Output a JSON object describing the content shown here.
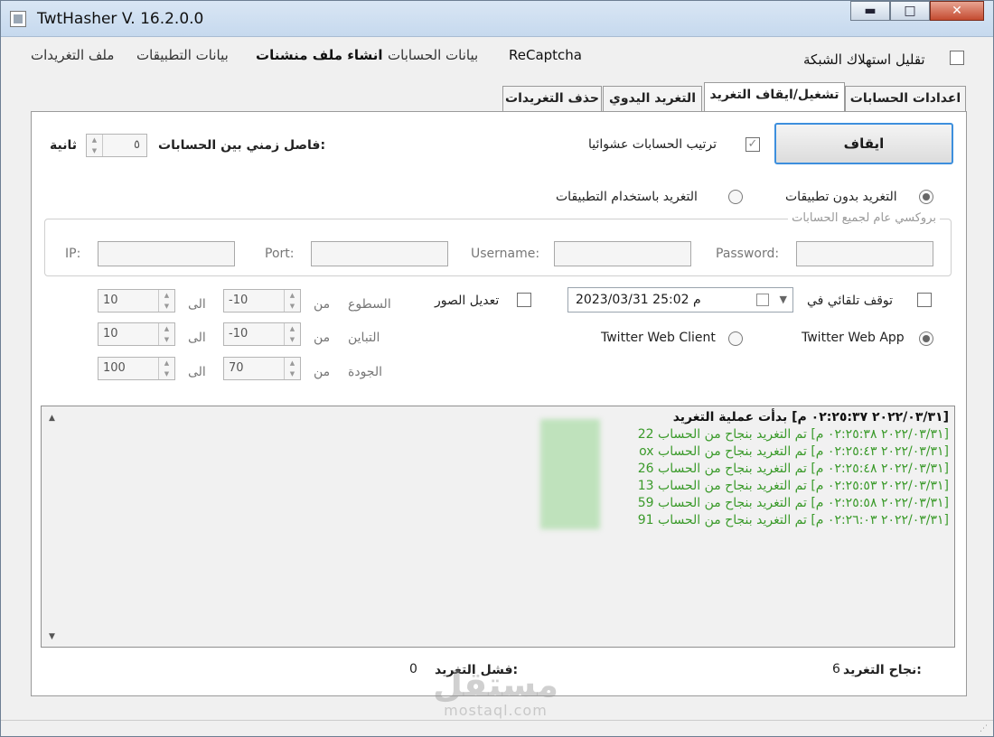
{
  "window": {
    "title": "TwtHasher V. 16.2.0.0",
    "minimize": "▬",
    "maximize": "□",
    "close": "✕"
  },
  "menu": {
    "reduce_network_label": "تقليل استهلاك الشبكة",
    "reduce_network_checked": false,
    "items": [
      "ReCaptcha",
      "بيانات الحسابات",
      "انشاء ملف منشنات",
      "بيانات التطبيقات",
      "ملف التغريدات"
    ]
  },
  "tabs": [
    "اعدادات الحسابات",
    "تشغيل/ايقاف التغريد",
    "التغريد اليدوي",
    "حذف التغريدات"
  ],
  "active_tab": 1,
  "controls": {
    "stop_button": "ايقاف",
    "random_order_label": "ترتيب الحسابات عشوائيا",
    "random_order_checked": true,
    "interval_label": "فاصل زمني بين الحسابات:",
    "interval_value": "٥",
    "interval_unit": "ثانية",
    "mode_no_apps": "التغريد بدون تطبيقات",
    "mode_with_apps": "التغريد باستخدام التطبيقات",
    "selected_mode": "no_apps"
  },
  "proxy": {
    "legend": "بروكسي عام لجميع الحسابات",
    "password_label": "Password:",
    "username_label": "Username:",
    "port_label": "Port:",
    "ip_label": "IP:",
    "password": "",
    "username": "",
    "port": "",
    "ip": ""
  },
  "schedule": {
    "auto_stop_label": "توقف تلقائي في",
    "auto_stop_checked": false,
    "date_value": "م  25:02 2023/03/31"
  },
  "image_edit": {
    "label": "تعديل الصور",
    "checked": false,
    "brightness": {
      "label": "السطوع",
      "from_label": "من",
      "from": "-10",
      "to_label": "الى",
      "to": "10"
    },
    "contrast": {
      "label": "التباين",
      "from_label": "من",
      "from": "-10",
      "to_label": "الى",
      "to": "10"
    },
    "quality": {
      "label": "الجودة",
      "from_label": "من",
      "from": "70",
      "to_label": "الى",
      "to": "100"
    }
  },
  "client": {
    "web_app": "Twitter Web App",
    "web_client": "Twitter Web Client",
    "selected": "web_app"
  },
  "log": {
    "lines": [
      {
        "type": "head",
        "text": "[٢٠٢٢/٠٣/٣١ ٠٢:٢٥:٣٧ م] بدأت عملية التغريد"
      },
      {
        "type": "ok",
        "text": "[٢٠٢٢/٠٣/٣١ ٠٢:٢٥:٣٨ م] تم التغريد بنجاح من الحساب 22"
      },
      {
        "type": "ok",
        "text": "[٢٠٢٢/٠٣/٣١ ٠٢:٢٥:٤٣ م] تم التغريد بنجاح من الحساب ox"
      },
      {
        "type": "ok",
        "text": "[٢٠٢٢/٠٣/٣١ ٠٢:٢٥:٤٨ م] تم التغريد بنجاح من الحساب 26"
      },
      {
        "type": "ok",
        "text": "[٢٠٢٢/٠٣/٣١ ٠٢:٢٥:٥٣ م] تم التغريد بنجاح من الحساب 13"
      },
      {
        "type": "ok",
        "text": "[٢٠٢٢/٠٣/٣١ ٠٢:٢٥:٥٨ م] تم التغريد بنجاح من الحساب 59"
      },
      {
        "type": "ok",
        "text": "[٢٠٢٢/٠٣/٣١ ٠٢:٢٦:٠٣ م] تم التغريد بنجاح من الحساب 91"
      }
    ]
  },
  "stats": {
    "success_label": "نجاح التغريد:",
    "success_value": "6",
    "fail_label": "فشل التغريد:",
    "fail_value": "0"
  },
  "watermark": {
    "big": "مستقل",
    "small": "mostaql.com"
  }
}
